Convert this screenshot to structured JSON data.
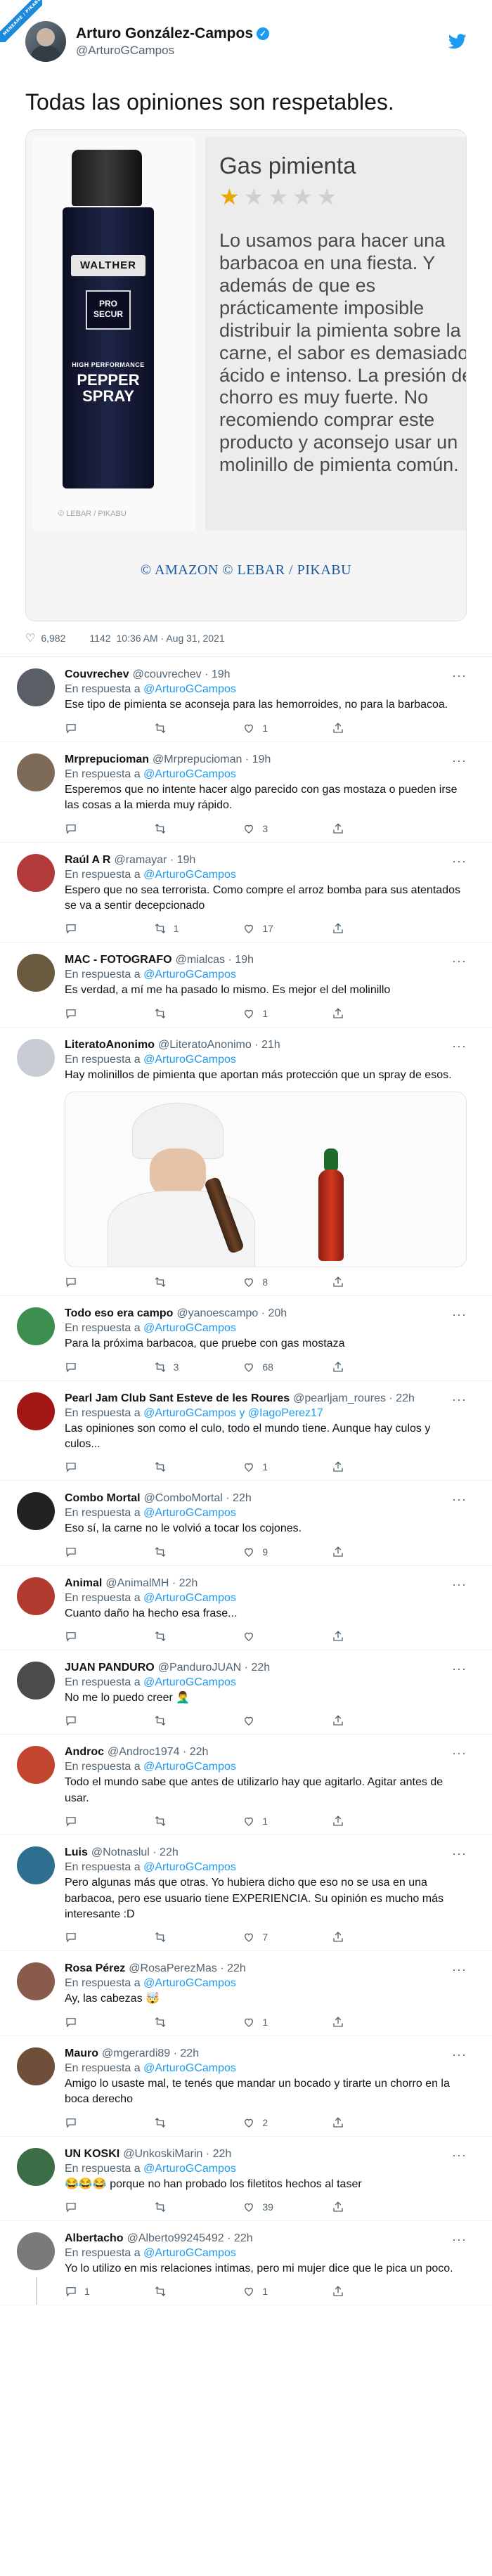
{
  "watermark": "MENEAME / PIKABU",
  "main": {
    "name": "Arturo González-Campos",
    "handle": "@ArturoGCampos",
    "text": "Todas las opiniones son respetables.",
    "likes": "6,982",
    "retweets": "1142",
    "timestamp": "10:36 AM · Aug 31, 2021",
    "media": {
      "product_brand": "WALTHER",
      "product_badge": "PRO SECUR",
      "product_sub": "HIGH PERFORMANCE",
      "product_name": "PEPPER SPRAY",
      "small_credit": "© LEBAR / PIKABU",
      "review_title": "Gas pimienta",
      "rating": 1,
      "rating_max": 5,
      "review_body": "Lo usamos para hacer una barbacoa en una fiesta. Y además de que es prácticamente imposible distribuir la pimienta sobre la carne, el sabor es demasiado ácido e intenso. La presión del chorro es muy fuerte. No recomiendo comprar este producto y aconsejo usar un molinillo de pimienta común.",
      "credit": "© AMAZON © LEBAR / PIKABU"
    }
  },
  "reply_prefix": "En respuesta a",
  "replies": [
    {
      "name": "Couvrechev",
      "handle": "@couvrechev · 19h",
      "to": "@ArturoGCampos",
      "text": "Ese tipo de pimienta se aconseja para las hemorroides, no para la barbacoa.",
      "replies": "",
      "retweets": "",
      "likes": "1",
      "avatar": "#5a5f66"
    },
    {
      "name": "Mrprepucioman",
      "handle": "@Mrprepucioman · 19h",
      "to": "@ArturoGCampos",
      "text": "Esperemos que no intente hacer algo parecido con gas mostaza o pueden irse las cosas a la mierda muy rápido.",
      "replies": "",
      "retweets": "",
      "likes": "3",
      "avatar": "#7d6b58"
    },
    {
      "name": "Raúl A R",
      "handle": "@ramayar · 19h",
      "to": "@ArturoGCampos",
      "text": "Espero que no sea terrorista. Como compre el arroz bomba para sus atentados se va a sentir decepcionado",
      "replies": "",
      "retweets": "1",
      "likes": "17",
      "avatar": "#b33a3a"
    },
    {
      "name": "MAC - FOTOGRAFO",
      "handle": "@mialcas · 19h",
      "to": "@ArturoGCampos",
      "text": "Es verdad, a mí me ha pasado lo mismo. Es mejor el del molinillo",
      "replies": "",
      "retweets": "",
      "likes": "1",
      "avatar": "#6a5a3e"
    },
    {
      "name": "LiteratoAnonimo",
      "handle": "@LiteratoAnonimo · 21h",
      "to": "@ArturoGCampos",
      "text": "Hay molinillos de pimienta que aportan más protección que un spray de esos.",
      "replies": "",
      "retweets": "",
      "likes": "8",
      "avatar": "#c7cdd2",
      "image": true
    },
    {
      "name": "Todo eso era campo",
      "handle": "@yanoescampo · 20h",
      "to": "@ArturoGCampos",
      "text": "Para la próxima barbacoa, que pruebe con gas mostaza",
      "replies": "",
      "retweets": "3",
      "likes": "68",
      "avatar": "#3d8f4f"
    },
    {
      "name": "Pearl Jam Club Sant Esteve de les Roures",
      "handle": "@pearljam_roures · 22h",
      "to": "@ArturoGCampos y @IagoPerez17",
      "text": "Las opiniones son como el culo, todo el mundo tiene. Aunque hay culos y culos...",
      "replies": "",
      "retweets": "",
      "likes": "1",
      "avatar": "#a21616"
    },
    {
      "name": "Combo Mortal",
      "handle": "@ComboMortal · 22h",
      "to": "@ArturoGCampos",
      "text": "Eso sí, la carne no le volvió a tocar los cojones.",
      "replies": "",
      "retweets": "",
      "likes": "9",
      "avatar": "#222222"
    },
    {
      "name": "Animal",
      "handle": "@AnimalMH · 22h",
      "to": "@ArturoGCampos",
      "text": "Cuanto daño ha hecho esa frase...",
      "replies": "",
      "retweets": "",
      "likes": "",
      "avatar": "#b23b2f"
    },
    {
      "name": "JUAN PANDURO",
      "handle": "@PanduroJUAN · 22h",
      "to": "@ArturoGCampos",
      "text": "No me lo puedo creer 🤦‍♂️",
      "replies": "",
      "retweets": "",
      "likes": "",
      "avatar": "#4b4b4b"
    },
    {
      "name": "Androc",
      "handle": "@Androc1974 · 22h",
      "to": "@ArturoGCampos",
      "text": "Todo el mundo sabe que antes de utilizarlo hay que agitarlo. Agitar antes de usar.",
      "replies": "",
      "retweets": "",
      "likes": "1",
      "avatar": "#c2452f"
    },
    {
      "name": "Luis",
      "handle": "@Notnaslul · 22h",
      "to": "@ArturoGCampos",
      "text": "Pero algunas más que otras. Yo hubiera dicho que eso no se usa en una barbacoa, pero ese usuario tiene EXPERIENCIA. Su opinión es mucho más interesante :D",
      "replies": "",
      "retweets": "",
      "likes": "7",
      "avatar": "#2e6e8e"
    },
    {
      "name": "Rosa Pérez",
      "handle": "@RosaPerezMas · 22h",
      "to": "@ArturoGCampos",
      "text": "Ay, las cabezas 🤯",
      "replies": "",
      "retweets": "",
      "likes": "1",
      "avatar": "#8a5a4a"
    },
    {
      "name": "Mauro",
      "handle": "@mgerardi89 · 22h",
      "to": "@ArturoGCampos",
      "text": "Amigo lo usaste mal, te tenés que mandar un bocado y tirarte un chorro en la boca derecho",
      "replies": "",
      "retweets": "",
      "likes": "2",
      "avatar": "#6f4e3a"
    },
    {
      "name": "UN KOSKI",
      "handle": "@UnkoskiMarin · 22h",
      "to": "@ArturoGCampos",
      "text": "😂😂😂 porque no han probado los filetitos hechos al taser",
      "replies": "",
      "retweets": "",
      "likes": "39",
      "avatar": "#3b6e46"
    },
    {
      "name": "Albertacho",
      "handle": "@Alberto99245492 · 22h",
      "to": "@ArturoGCampos",
      "text": "Yo lo utilizo en mis relaciones intimas, pero mi mujer dice que le pica un poco.",
      "replies": "1",
      "retweets": "",
      "likes": "1",
      "avatar": "#7a7a7a"
    }
  ]
}
